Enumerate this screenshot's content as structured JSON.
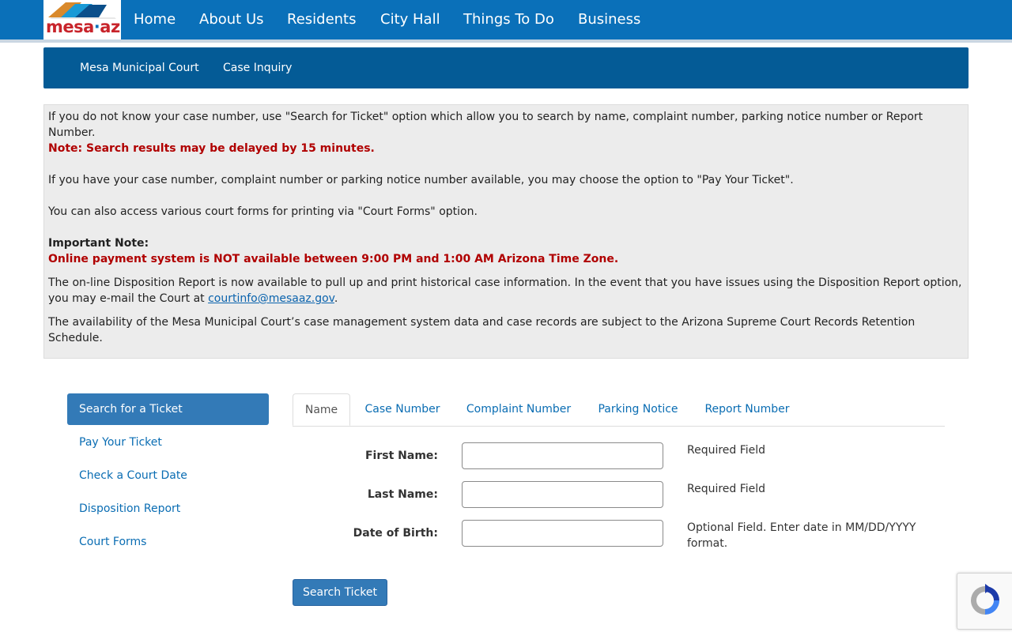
{
  "logo": {
    "name": "mesa",
    "sep": "·",
    "suffix": "az"
  },
  "topnav": {
    "items": [
      "Home",
      "About Us",
      "Residents",
      "City Hall",
      "Things To Do",
      "Business"
    ]
  },
  "subnav": {
    "items": [
      "Mesa Municipal Court",
      "Case Inquiry"
    ]
  },
  "info": {
    "p1": "If you do not know your case number, use \"Search for Ticket\" option which allow you to search by name, complaint number, parking notice number or Report Number.",
    "note": "Note: Search results may be delayed by 15 minutes.",
    "p2": "If you have your case number, complaint number or parking notice number available, you may choose the option to \"Pay Your Ticket\".",
    "p3": "You can also access various court forms for printing via \"Court Forms\" option.",
    "important_label": "Important Note:",
    "important_text": "Online payment system is NOT available between 9:00 PM and 1:00 AM Arizona Time Zone.",
    "p4_before": "The on-line Disposition Report is now available to pull up and print historical case information. In the event that you have issues using the Disposition Report option, you may e-mail the Court at ",
    "email": "courtinfo@mesaaz.gov",
    "p4_after": ".",
    "p5": "The availability of the Mesa Municipal Court’s case management system data and case records are subject to the Arizona Supreme Court Records Retention Schedule."
  },
  "sidebar": {
    "items": [
      {
        "label": "Search for a Ticket",
        "active": true
      },
      {
        "label": "Pay Your Ticket",
        "active": false
      },
      {
        "label": "Check a Court Date",
        "active": false
      },
      {
        "label": "Disposition Report",
        "active": false
      },
      {
        "label": "Court Forms",
        "active": false
      }
    ]
  },
  "tabs": {
    "items": [
      "Name",
      "Case Number",
      "Complaint Number",
      "Parking Notice",
      "Report Number"
    ],
    "active": "Name"
  },
  "form": {
    "first_name": {
      "label": "First Name:",
      "value": "",
      "hint": "Required Field"
    },
    "last_name": {
      "label": "Last Name:",
      "value": "",
      "hint": "Required Field"
    },
    "dob": {
      "label": "Date of Birth:",
      "value": "",
      "hint": "Optional Field. Enter date in MM/DD/YYYY format."
    },
    "submit_label": "Search Ticket"
  },
  "colors": {
    "topnav": "#0a70b9",
    "subnav": "#045b96",
    "accent": "#337ab7",
    "link": "#0a6db3",
    "alert_red": "#b00000",
    "logo_red": "#c8242b"
  }
}
